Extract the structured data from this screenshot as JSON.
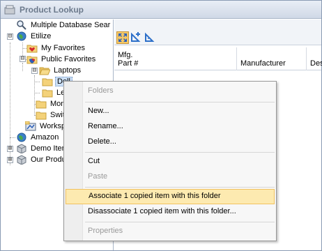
{
  "window": {
    "title": "Product Lookup"
  },
  "tree": {
    "items": [
      {
        "label": "Multiple Database Sear",
        "icon": "search-icon"
      },
      {
        "label": "Etilize",
        "icon": "globe-icon",
        "expander": "⊟"
      },
      {
        "label": "My Favorites",
        "icon": "heart-folder-icon"
      },
      {
        "label": "Public Favorites",
        "icon": "shield-folder-icon",
        "expander": "⊟"
      },
      {
        "label": "Laptops",
        "icon": "folder-open-icon",
        "expander": "⊟"
      },
      {
        "label": "Dell",
        "icon": "folder-icon"
      },
      {
        "label": "Le",
        "icon": "folder-icon"
      },
      {
        "label": "Mon",
        "icon": "folder-icon"
      },
      {
        "label": "Swit",
        "icon": "folder-icon"
      },
      {
        "label": "Worksp",
        "icon": "workspace-icon"
      },
      {
        "label": "Amazon",
        "icon": "globe-icon"
      },
      {
        "label": "Demo Iten",
        "icon": "package-icon",
        "expander": "⊞"
      },
      {
        "label": "Our Produ",
        "icon": "package-icon",
        "expander": "⊞"
      }
    ]
  },
  "grid": {
    "columns": [
      {
        "line1": "Mfg.",
        "line2": "Part #"
      },
      {
        "line1": "",
        "line2": "Manufacturer"
      },
      {
        "line1": "",
        "line2": "Des"
      }
    ]
  },
  "context_menu": {
    "items": [
      {
        "label": "Folders",
        "state": "disabled"
      },
      {
        "label": "New...",
        "accel": "N"
      },
      {
        "label": "Rename...",
        "accel": "R"
      },
      {
        "label": "Delete...",
        "accel": "D"
      },
      {
        "label": "Cut",
        "accel": ""
      },
      {
        "label": "Paste",
        "state": "disabled"
      },
      {
        "label": "Associate 1 copied item with this folder",
        "state": "highlighted"
      },
      {
        "label": "Disassociate 1 copied item with this folder...",
        "state": "normal"
      },
      {
        "label": "Properties",
        "state": "disabled"
      }
    ]
  },
  "colors": {
    "highlight_fill": "#fdeab0",
    "highlight_border": "#f1c15f",
    "selection": "#cce0f6",
    "folder": "#f4d27a"
  }
}
